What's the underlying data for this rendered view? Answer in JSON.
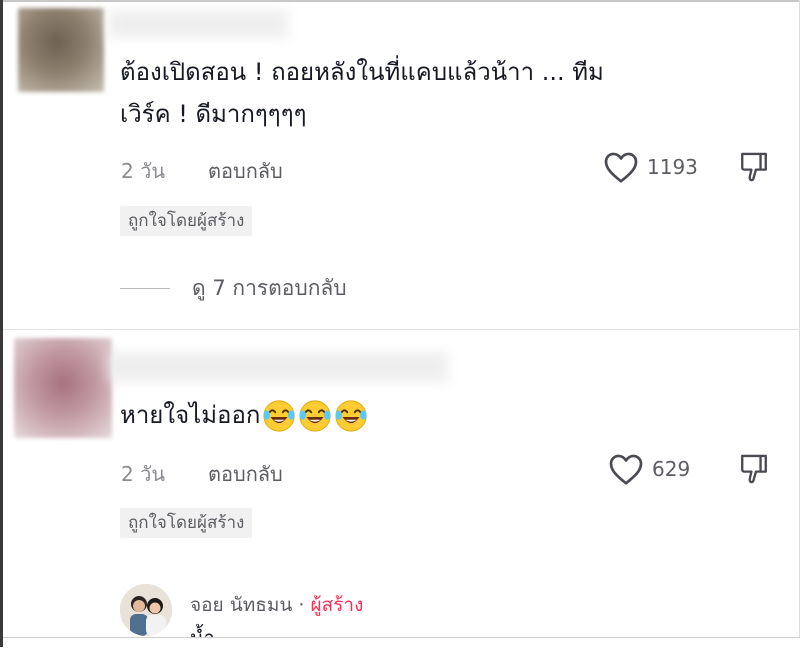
{
  "comments": [
    {
      "text_line1": "ต้องเปิดสอน ! ถอยหลังในที่แคบแล้วน้าา ... ทีม",
      "text_line2": "เวิร์ค ! ดีมากๆๆๆๆ",
      "time": "2 วัน",
      "reply_label": "ตอบกลับ",
      "likes": "1193",
      "badge": "ถูกใจโดยผู้สร้าง",
      "view_replies": "ดู 7 การตอบกลับ",
      "avatar_color": "#8b7d6b"
    },
    {
      "text": "หายใจไม่ออก",
      "emoji": [
        "laughing-tears-emoji",
        "laughing-tears-emoji",
        "laughing-tears-emoji"
      ],
      "time": "2 วัน",
      "reply_label": "ตอบกลับ",
      "likes": "629",
      "badge": "ถูกใจโดยผู้สร้าง",
      "avatar_color": "#b98d95"
    }
  ],
  "reply": {
    "author": "จอย นัทธมน",
    "separator": " · ",
    "creator_tag": "ผู้สร้าง",
    "text_peek": "น้ำ ..."
  },
  "colors": {
    "creator_accent": "#fe2c55",
    "secondary_text": "#8a8b91",
    "badge_bg": "#f1f1f2"
  }
}
